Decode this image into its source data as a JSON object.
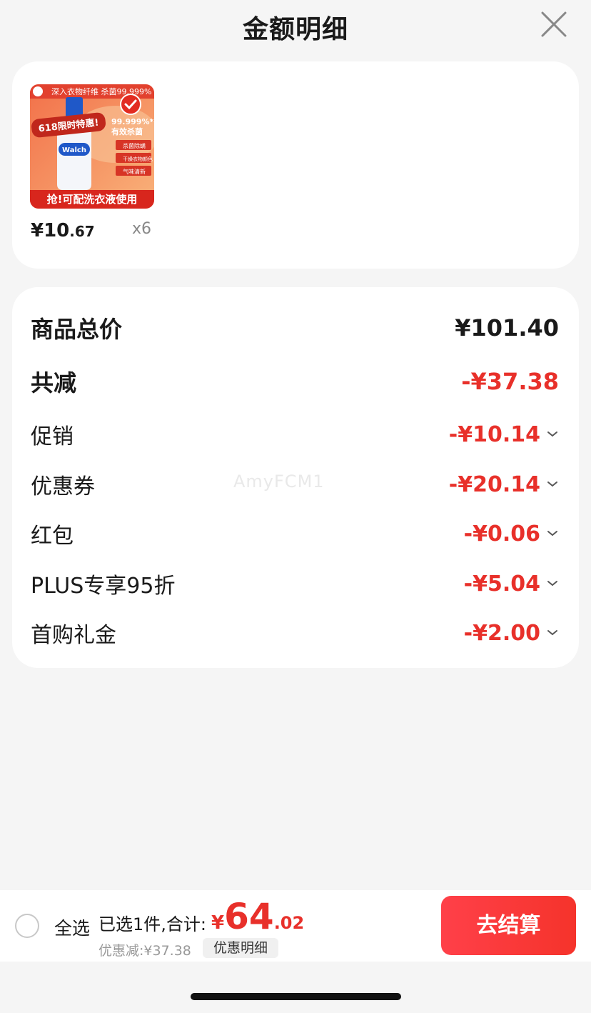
{
  "header": {
    "title": "金额明细"
  },
  "product": {
    "image_icon": "product-image",
    "banner_top": "深入衣物纤维 杀菌99.999%",
    "badge": "618限时特惠!",
    "claim_1": "99.999%*",
    "claim_2": "有效杀菌",
    "feature_1": "杀菌除螨",
    "feature_2": "干燥衣物颜色",
    "feature_3": "气味清新",
    "banner_bottom": "抢!可配洗衣液使用",
    "brand": "Walch",
    "price_int": "¥10",
    "price_dec": ".67",
    "quantity": "x6"
  },
  "summary": {
    "subtotal_label": "商品总价",
    "subtotal_value": "¥101.40",
    "total_discount_label": "共减",
    "total_discount_value": "-¥37.38",
    "items": [
      {
        "label": "促销",
        "value": "-¥10.14"
      },
      {
        "label": "优惠券",
        "value": "-¥20.14"
      },
      {
        "label": "红包",
        "value": "-¥0.06"
      },
      {
        "label": "PLUS专享95折",
        "value": "-¥5.04"
      },
      {
        "label": "首购礼金",
        "value": "-¥2.00"
      }
    ],
    "watermark": "AmyFCM1"
  },
  "bottom_bar": {
    "select_all": "全选",
    "selected_text": "已选1件,合计:",
    "total_symbol": "¥",
    "total_int": "64",
    "total_dec": ".02",
    "discount_text": "优惠减:¥37.38",
    "detail_button": "优惠明细",
    "checkout_button": "去结算"
  },
  "colors": {
    "accent": "#e8302a",
    "checkout": "#f5332b",
    "background": "#f5f5f5"
  }
}
